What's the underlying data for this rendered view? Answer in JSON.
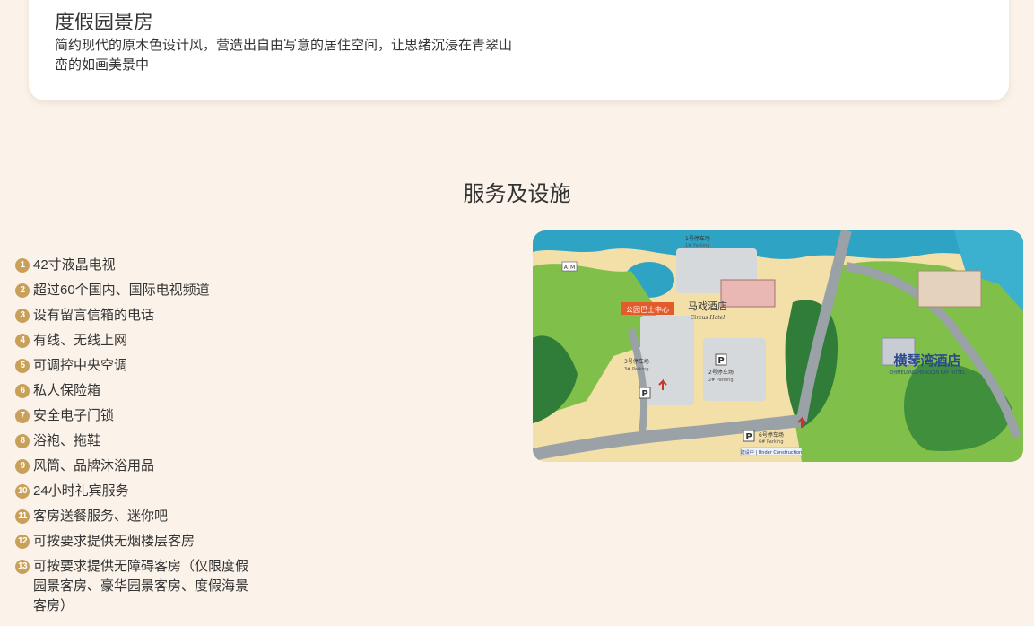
{
  "room": {
    "title": "度假园景房",
    "description": "简约现代的原木色设计风，营造出自由写意的居住空间，让思绪沉浸在青翠山峦的如画美景中"
  },
  "services": {
    "title": "服务及设施",
    "items": [
      {
        "num": "1",
        "text": "42寸液晶电视"
      },
      {
        "num": "2",
        "text": "超过60个国内、国际电视频道"
      },
      {
        "num": "3",
        "text": "设有留言信箱的电话"
      },
      {
        "num": "4",
        "text": "有线、无线上网"
      },
      {
        "num": "5",
        "text": "可调控中央空调"
      },
      {
        "num": "6",
        "text": "私人保险箱"
      },
      {
        "num": "7",
        "text": "安全电子门锁"
      },
      {
        "num": "8",
        "text": "浴袍、拖鞋"
      },
      {
        "num": "9",
        "text": "风筒、品牌沐浴用品"
      },
      {
        "num": "10",
        "text": "24小时礼宾服务"
      },
      {
        "num": "11",
        "text": "客房送餐服务、迷你吧"
      },
      {
        "num": "12",
        "text": "可按要求提供无烟楼层客房"
      },
      {
        "num": "13",
        "text": "可按要求提供无障碍客房（仅限度假园景客房、豪华园景客房、度假海景客房）"
      }
    ]
  },
  "map": {
    "hotel_name": "横琴湾酒店",
    "hotel_name_en": "CHIMELONG HENGQIN BAY HOTEL",
    "circus_hotel": "马戏酒店",
    "circus_hotel_en": "Circus Hotel",
    "bus_stop": "公园巴士中心",
    "parking_1": "1号停车场",
    "parking_1_en": "1# Parking",
    "parking_2": "2号停车场",
    "parking_2_en": "2# Parking",
    "parking_3": "3号停车场",
    "parking_3_en": "3# Parking",
    "parking_6": "6号停车场",
    "parking_6_en": "6# Parking",
    "under_construction": "建设中 | Under Construction",
    "atm": "ATM",
    "colors": {
      "sea": "#2fa3c4",
      "grass": "#7fbf4a",
      "tree": "#2f7d38",
      "sand": "#f3dfa8",
      "road": "#9aa1a7"
    }
  }
}
